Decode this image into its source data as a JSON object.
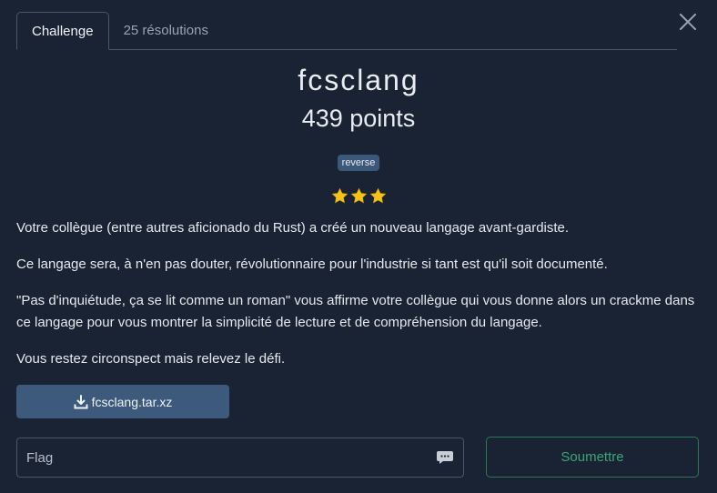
{
  "tabs": [
    {
      "label": "Challenge",
      "active": true
    },
    {
      "label": "25 résolutions",
      "active": false
    }
  ],
  "challenge": {
    "name": "fcsclang",
    "points": "439 points",
    "tag": "reverse",
    "rating": 3,
    "description": [
      "Votre collègue (entre autres aficionado du Rust) a créé un nouveau langage avant-gardiste.",
      "Ce langage sera, à n'en pas douter, révolutionnaire pour l'industrie si tant est qu'il soit documenté.",
      "\"Pas d'inquiétude, ça se lit comme un roman\" vous affirme votre collègue qui vous donne alors un crackme dans ce langage pour vous montrer la simplicité de lecture et de compréhension du langage.",
      "Vous restez circonspect mais relevez le défi."
    ],
    "file": "fcsclang.tar.xz"
  },
  "form": {
    "flag_placeholder": "Flag",
    "flag_value": "",
    "submit_label": "Soumettre"
  },
  "colors": {
    "background": "#1a2333",
    "tag_bg": "#3c5879",
    "download_bg": "#3d5a7c",
    "star": "#f7c21a",
    "submit": "#3aa676"
  }
}
